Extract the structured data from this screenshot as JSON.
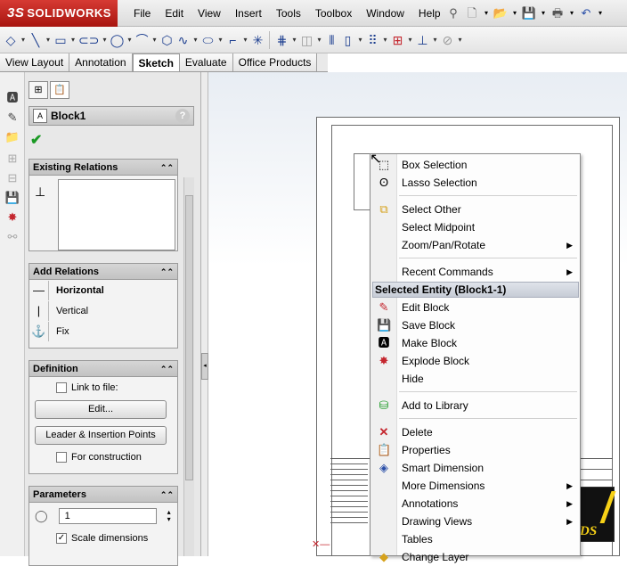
{
  "app": {
    "logo_prefix": "3S",
    "logo_name": "SOLIDWORKS"
  },
  "menu": [
    "File",
    "Edit",
    "View",
    "Insert",
    "Tools",
    "Toolbox",
    "Window",
    "Help"
  ],
  "tabs": [
    {
      "label": "View Layout",
      "active": false
    },
    {
      "label": "Annotation",
      "active": false
    },
    {
      "label": "Sketch",
      "active": true
    },
    {
      "label": "Evaluate",
      "active": false
    },
    {
      "label": "Office Products",
      "active": false
    }
  ],
  "property_manager": {
    "title": "Block1",
    "help": "?",
    "existing_relations": {
      "header": "Existing Relations"
    },
    "add_relations": {
      "header": "Add Relations",
      "items": [
        "Horizontal",
        "Vertical",
        "Fix"
      ]
    },
    "definition": {
      "header": "Definition",
      "link_to_file": "Link to file:",
      "edit_button": "Edit...",
      "leader_button": "Leader & Insertion Points",
      "for_construction": "For construction"
    },
    "parameters": {
      "header": "Parameters",
      "value": "1",
      "scale_dimensions": "Scale dimensions",
      "scale_checked": true
    }
  },
  "context_menu": {
    "items1": [
      {
        "label": "Box Selection",
        "icon": "box-selection-icon"
      },
      {
        "label": "Lasso Selection",
        "icon": "lasso-icon"
      }
    ],
    "items2": [
      {
        "label": "Select Other",
        "icon": "select-other-icon"
      },
      {
        "label": "Select Midpoint",
        "icon": ""
      },
      {
        "label": "Zoom/Pan/Rotate",
        "icon": "",
        "submenu": true
      }
    ],
    "items3": [
      {
        "label": "Recent Commands",
        "icon": "",
        "submenu": true
      }
    ],
    "selected_header": "Selected Entity (Block1-1)",
    "items4": [
      {
        "label": "Edit Block",
        "icon": "edit-block-icon"
      },
      {
        "label": "Save Block",
        "icon": "save-block-icon"
      },
      {
        "label": "Make Block",
        "icon": "make-block-icon"
      },
      {
        "label": "Explode Block",
        "icon": "explode-block-icon"
      },
      {
        "label": "Hide",
        "icon": ""
      }
    ],
    "items5": [
      {
        "label": "Add to Library",
        "icon": "add-library-icon"
      }
    ],
    "items6": [
      {
        "label": "Delete",
        "icon": "delete-icon"
      },
      {
        "label": "Properties",
        "icon": "properties-icon"
      },
      {
        "label": "Smart Dimension",
        "icon": "smart-dimension-icon"
      },
      {
        "label": "More Dimensions",
        "icon": "",
        "submenu": true
      },
      {
        "label": "Annotations",
        "icon": "",
        "submenu": true
      },
      {
        "label": "Drawing Views",
        "icon": "",
        "submenu": true
      },
      {
        "label": "Tables",
        "icon": ""
      },
      {
        "label": "Change Layer",
        "icon": "change-layer-icon"
      }
    ]
  },
  "watermark": "VDS",
  "colors": {
    "accent": "#c4262e",
    "ok": "#1b9a25",
    "watermark": "#f7d117"
  }
}
